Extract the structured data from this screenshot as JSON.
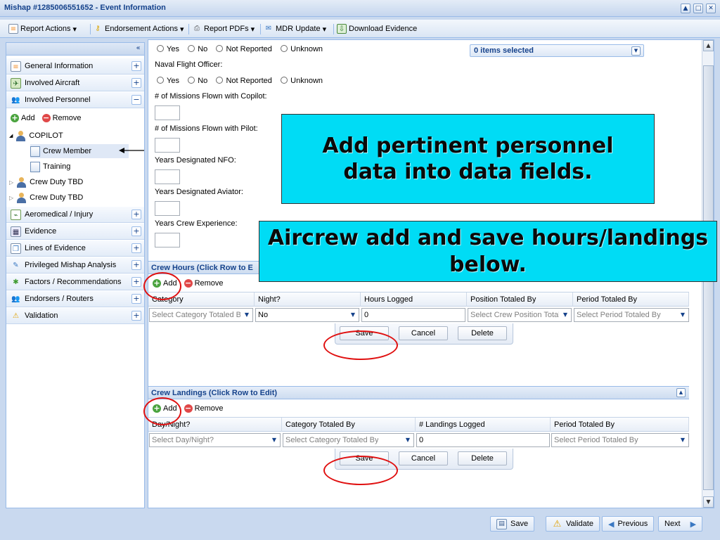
{
  "window": {
    "title": "Mishap #1285006551652 - Event Information",
    "buttons": [
      "▲",
      "□",
      "✕"
    ]
  },
  "toolbar": {
    "report_actions": "Report Actions",
    "endorsement_actions": "Endorsement Actions",
    "report_pdfs": "Report PDFs",
    "mdr_update": "MDR Update",
    "download_evidence": "Download Evidence",
    "dropdown_caret": "▾"
  },
  "nav": {
    "collapse": "«",
    "items": [
      {
        "label": "General Information",
        "exp": "+"
      },
      {
        "label": "Involved Aircraft",
        "exp": "+"
      },
      {
        "label": "Involved Personnel",
        "exp": "−"
      },
      {
        "label": "Aeromedical / Injury",
        "exp": "+"
      },
      {
        "label": "Evidence",
        "exp": "+"
      },
      {
        "label": "Lines of Evidence",
        "exp": "+"
      },
      {
        "label": "Privileged Mishap Analysis",
        "exp": "+"
      },
      {
        "label": "Factors / Recommendations",
        "exp": "+"
      },
      {
        "label": "Endorsers / Routers",
        "exp": "+"
      },
      {
        "label": "Validation",
        "exp": "+"
      }
    ],
    "add": "Add",
    "remove": "Remove",
    "tree": {
      "copilot": "COPILOT",
      "crew_member": "Crew Member",
      "training": "Training",
      "crew_duty_1": "Crew Duty TBD",
      "crew_duty_2": "Crew Duty TBD",
      "expanded_marker": "◢",
      "collapsed_marker": "▷"
    }
  },
  "form": {
    "radio_options": [
      "Yes",
      "No",
      "Not Reported",
      "Unknown"
    ],
    "naval_flight_officer": "Naval Flight Officer:",
    "missions_copilot": "# of Missions Flown with Copilot:",
    "missions_pilot": "# of Missions Flown with Pilot:",
    "years_nfo": "Years Designated NFO:",
    "years_aviator": "Years Designated Aviator:",
    "years_crew": "Years Crew Experience:",
    "multiselect": "0 items selected"
  },
  "crew_hours": {
    "title": "Crew Hours (Click Row to E",
    "add": "Add",
    "remove": "Remove",
    "columns": [
      "Category",
      "Night?",
      "Hours Logged",
      "Position Totaled By",
      "Period Totaled By"
    ],
    "edit": {
      "category": "Select Category Totaled By",
      "night": "No",
      "hours": "0",
      "position": "Select Crew Position Total",
      "period": "Select Period Totaled By"
    },
    "save": "Save",
    "cancel": "Cancel",
    "delete": "Delete"
  },
  "crew_landings": {
    "title": "Crew Landings (Click Row to Edit)",
    "add": "Add",
    "remove": "Remove",
    "columns": [
      "Day/Night?",
      "Category Totaled By",
      "# Landings Logged",
      "Period Totaled By"
    ],
    "edit": {
      "daynight": "Select Day/Night?",
      "category": "Select Category Totaled By",
      "landings": "0",
      "period": "Select Period Totaled By"
    },
    "save": "Save",
    "cancel": "Cancel",
    "delete": "Delete"
  },
  "callouts": {
    "personnel": "Add pertinent personnel data into data fields.",
    "hours": "Aircrew add and save hours/landings below."
  },
  "bottom": {
    "save": "Save",
    "validate": "Validate",
    "previous": "Previous",
    "next": "Next"
  },
  "colors": {
    "accent": "#15428b",
    "callout": "#00dcf5",
    "highlight_ring": "#e01010"
  }
}
